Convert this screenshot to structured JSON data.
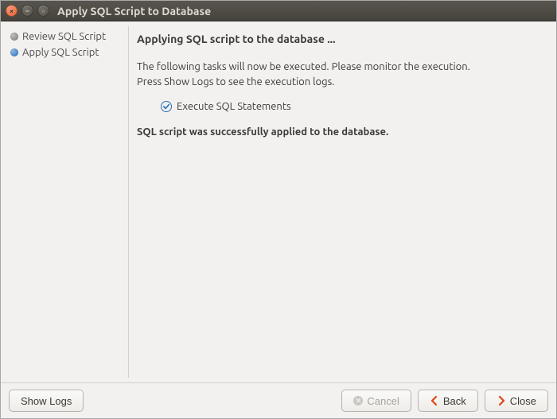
{
  "window": {
    "title": "Apply SQL Script to Database"
  },
  "sidebar": {
    "steps": [
      {
        "label": "Review SQL Script",
        "active": false
      },
      {
        "label": "Apply SQL Script",
        "active": true
      }
    ]
  },
  "main": {
    "heading": "Applying SQL script to the database ...",
    "desc_line1": "The following tasks will now be executed. Please monitor the execution.",
    "desc_line2": "Press Show Logs to see the execution logs.",
    "task_label": "Execute SQL Statements",
    "success_msg": "SQL script was successfully applied to the database."
  },
  "buttons": {
    "show_logs": "Show Logs",
    "cancel": "Cancel",
    "back": "Back",
    "close": "Close"
  }
}
